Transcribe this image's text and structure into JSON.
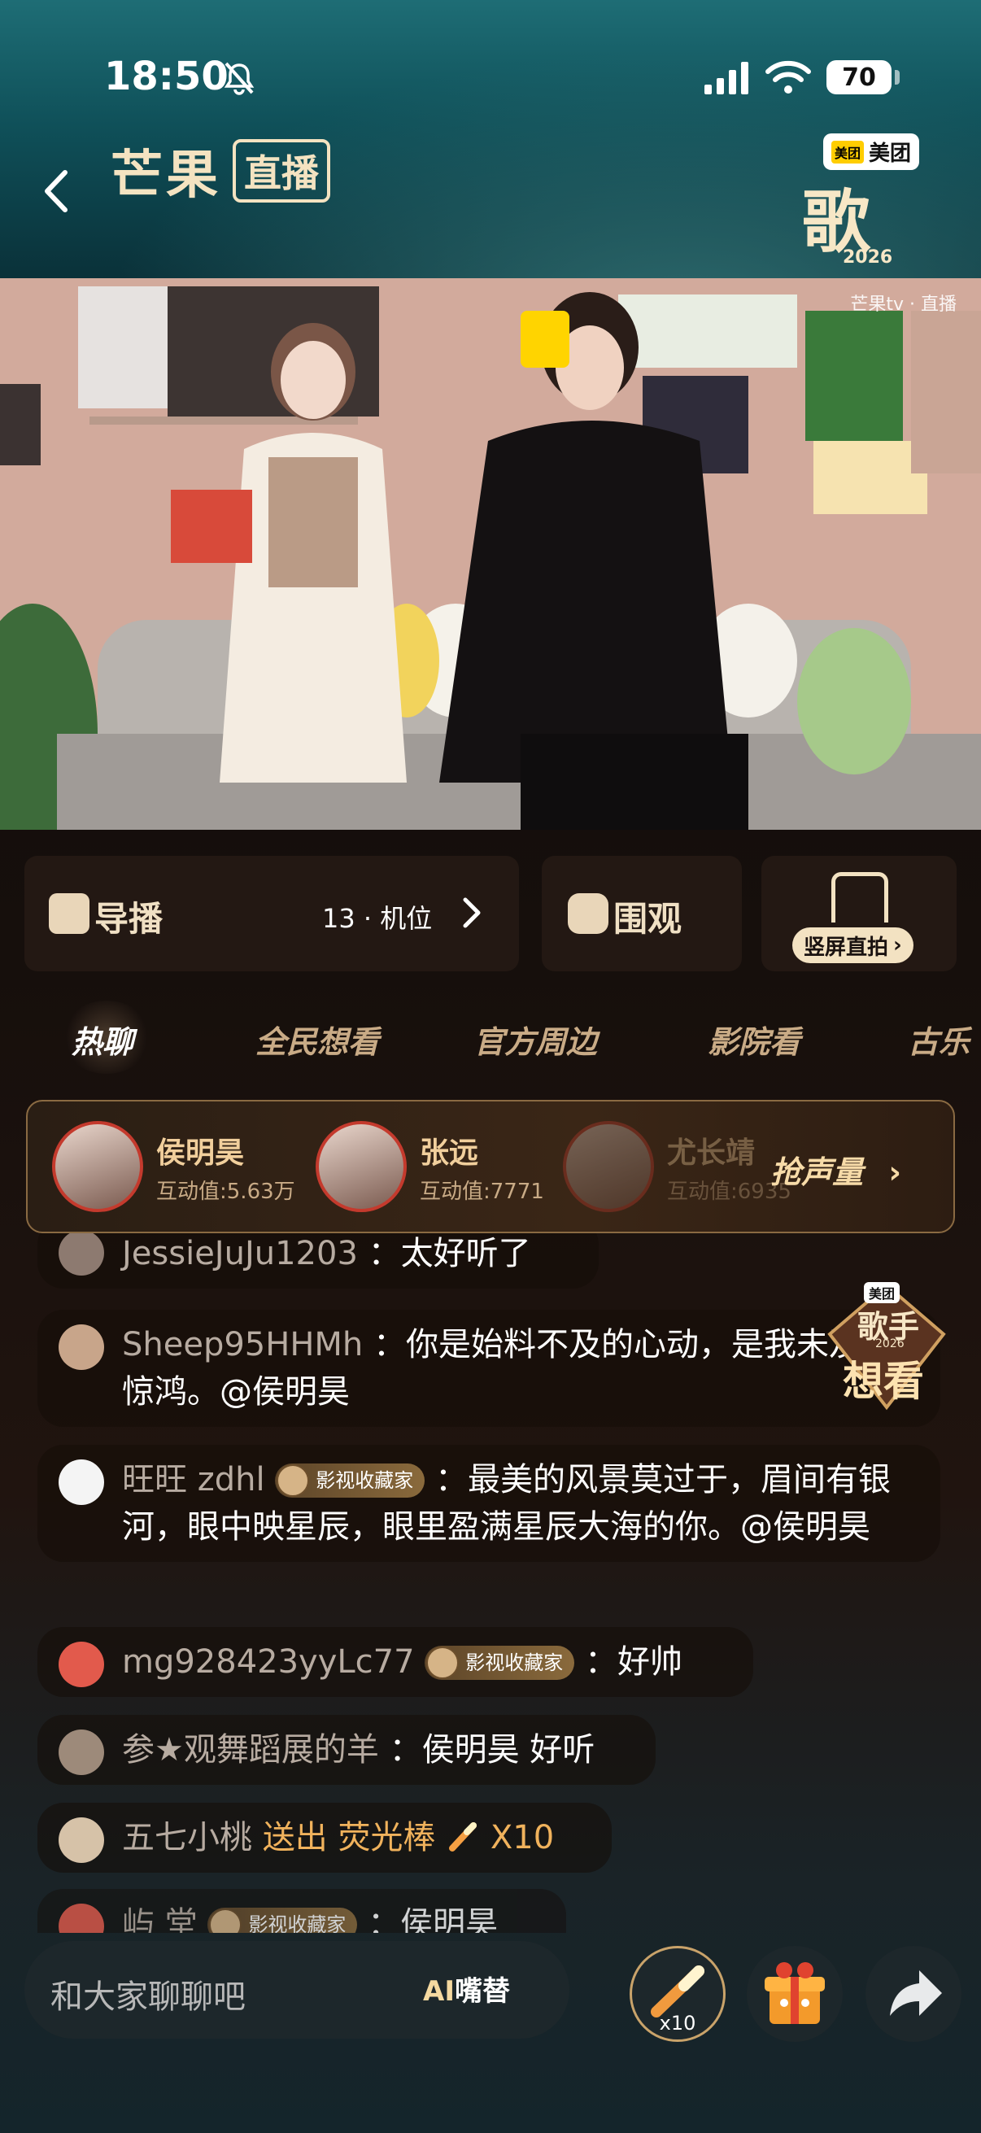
{
  "status_bar": {
    "time": "18:50",
    "battery": "70"
  },
  "header": {
    "logo_main": "芒果",
    "logo_tag": "直播",
    "sponsor": "美团",
    "sponsor_mark": "美团",
    "show_title": "歌手",
    "show_year": "2026"
  },
  "video": {
    "watermark": "芒果tv · 直播"
  },
  "controls": {
    "director_label": "导播",
    "camera_count": "13 · 机位",
    "onlooker_label": "围观",
    "vertical_cam_label": "竖屏直拍"
  },
  "tabs": [
    {
      "label": "热聊",
      "active": true
    },
    {
      "label": "全民想看"
    },
    {
      "label": "官方周边"
    },
    {
      "label": "影院看"
    },
    {
      "label": "古乐"
    }
  ],
  "singers": [
    {
      "name": "侯明昊",
      "score": "互动值:5.63万"
    },
    {
      "name": "张远",
      "score": "互动值:7771"
    },
    {
      "name": "尤长靖",
      "score": "互动值:6935"
    }
  ],
  "grab_volume_label": "抢声量",
  "want_badge": {
    "sponsor": "美团",
    "title": "歌手",
    "year": "2026",
    "label": "想看"
  },
  "chat": [
    {
      "user": "JessieJuJu1203",
      "text": "：太好听了"
    },
    {
      "user": "Sheep95HHMh",
      "text": "：你是始料不及的心动，是我未及的惊鸿。@侯明昊"
    },
    {
      "user": "旺旺 zdhl",
      "badge": "影视收藏家",
      "text": "：最美的风景莫过于，眉间有银河，眼中映星辰，眼里盈满星辰大海的你。@侯明昊"
    },
    {
      "user": "mg928423yyLc77",
      "badge": "影视收藏家",
      "text": "：好帅"
    },
    {
      "user": "参★观舞蹈展的羊",
      "text": "：侯明昊 好听"
    },
    {
      "user": "五七小桃",
      "gift_action": "送出",
      "gift_name": "荧光棒",
      "gift_count": "X10"
    },
    {
      "user": "屿 堂",
      "badge": "影视收藏家",
      "text": "：侯明昊"
    }
  ],
  "bottom_bar": {
    "input_placeholder": "和大家聊聊吧",
    "ai_label_prefix": "AI",
    "ai_label": "嘴替",
    "wand_count": "x10"
  }
}
